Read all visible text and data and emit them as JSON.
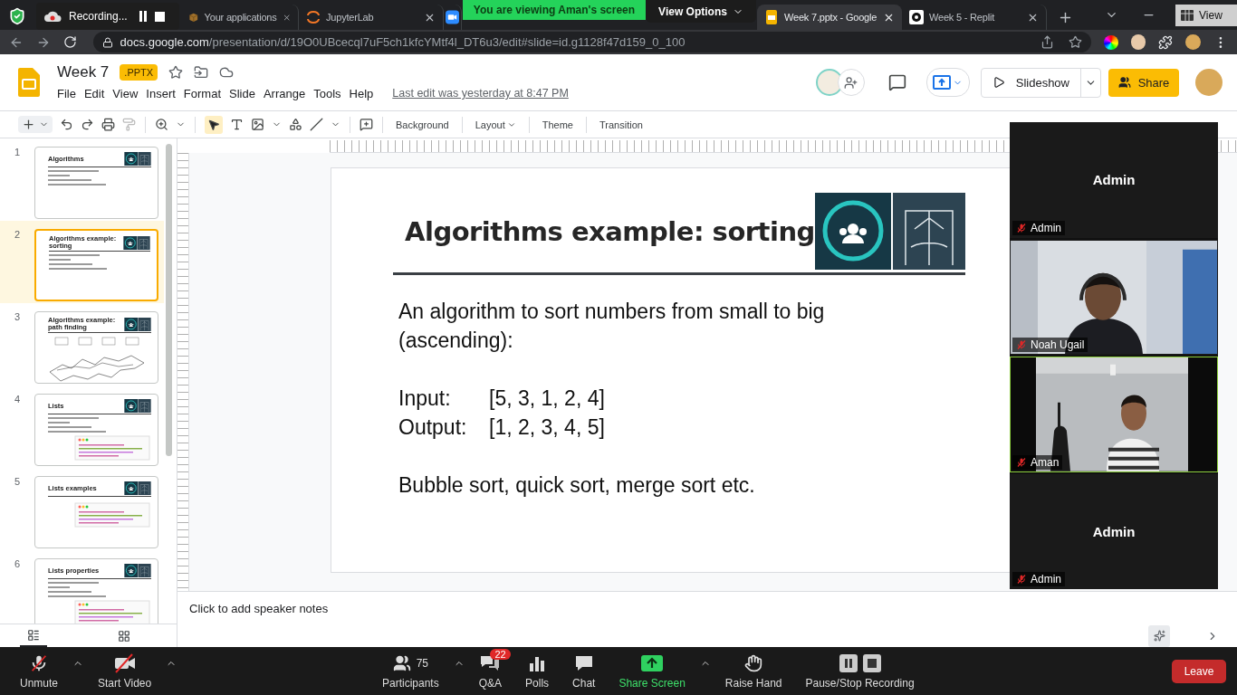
{
  "browser": {
    "tabs": [
      {
        "title": "Your applications",
        "selected": false,
        "kind": "box"
      },
      {
        "title": "JupyterLab",
        "selected": false,
        "kind": "jupyter"
      },
      {
        "selected": false,
        "kind": "zoom"
      },
      {
        "title": "Week 7.pptx - Google",
        "selected": true,
        "kind": "slides"
      },
      {
        "title": "Week 5 - Replit",
        "selected": false,
        "kind": "replit"
      }
    ],
    "url_domain": "docs.google.com",
    "url_path": "/presentation/d/19O0UBcecql7uF5ch1kfcYMtf4l_DT6u3/edit#slide=id.g1128f47d159_0_100"
  },
  "zoom_overlays": {
    "recording": "Recording...",
    "banner": "You are viewing Aman's screen",
    "view_options": "View Options",
    "view": "View"
  },
  "docs": {
    "title": "Week 7",
    "badge": ".PPTX",
    "menu": [
      "File",
      "Edit",
      "View",
      "Insert",
      "Format",
      "Slide",
      "Arrange",
      "Tools",
      "Help"
    ],
    "last_edit": "Last edit was yesterday at 8:47 PM",
    "slideshow": "Slideshow",
    "share": "Share"
  },
  "toolbar": [
    {
      "label": "Background",
      "kind": "button"
    },
    {
      "label": "Layout",
      "kind": "menu"
    },
    {
      "label": "Theme",
      "kind": "button"
    },
    {
      "label": "Transition",
      "kind": "button"
    }
  ],
  "filmstrip": [
    {
      "number": "1",
      "selected": false,
      "kind": "text",
      "title": "Algorithms"
    },
    {
      "number": "2",
      "selected": true,
      "kind": "text",
      "title": "Algorithms example: sorting"
    },
    {
      "number": "3",
      "selected": false,
      "kind": "maze",
      "title": "Algorithms example: path finding"
    },
    {
      "number": "4",
      "selected": false,
      "kind": "code",
      "title": "Lists"
    },
    {
      "number": "5",
      "selected": false,
      "kind": "code",
      "title": "Lists examples"
    },
    {
      "number": "6",
      "selected": false,
      "kind": "code",
      "title": "Lists properties"
    }
  ],
  "slide": {
    "title": "Algorithms example: sorting",
    "intro": "An algorithm to sort numbers from small to big (ascending):",
    "pairs": [
      {
        "label": "Input:",
        "value": "[5, 3, 1, 2, 4]"
      },
      {
        "label": "Output:",
        "value": "[1, 2, 3, 4, 5]"
      }
    ],
    "closing": "Bubble sort, quick sort, merge sort etc."
  },
  "notes_placeholder": "Click to add speaker notes",
  "videos": [
    {
      "name": "Admin",
      "label": "Admin",
      "kind": "name",
      "active": false
    },
    {
      "label": "Noah Ugail",
      "kind": "video",
      "active": false
    },
    {
      "label": "Aman",
      "kind": "video",
      "active": true
    },
    {
      "name": "Admin",
      "label": "Admin",
      "kind": "name",
      "active": false
    }
  ],
  "meeting_bar": {
    "left": [
      {
        "kind": "mic",
        "label": "Unmute",
        "menu": true
      },
      {
        "kind": "camera",
        "label": "Start Video",
        "menu": true
      }
    ],
    "center": [
      {
        "kind": "participants",
        "label": "Participants",
        "count": "75",
        "menu": true
      },
      {
        "kind": "qa",
        "label": "Q&A",
        "badge": "22",
        "menu": false
      },
      {
        "kind": "polls",
        "label": "Polls",
        "menu": false
      },
      {
        "kind": "chat",
        "label": "Chat",
        "menu": false
      },
      {
        "kind": "share",
        "label": "Share Screen",
        "menu": true
      },
      {
        "kind": "hand",
        "label": "Raise Hand",
        "menu": false
      },
      {
        "kind": "recording",
        "label": "Pause/Stop Recording",
        "menu": false
      }
    ],
    "leave": "Leave"
  }
}
